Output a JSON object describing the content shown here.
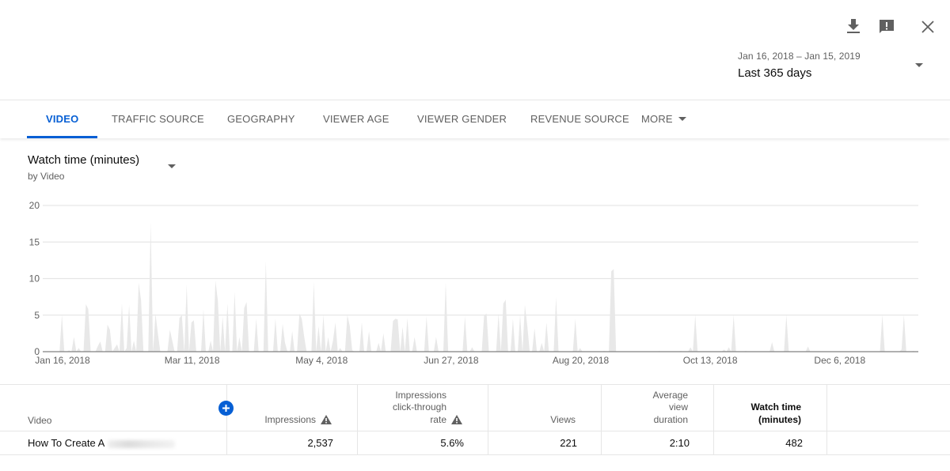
{
  "header": {
    "icons": [
      "download-icon",
      "feedback-icon",
      "close-icon"
    ],
    "date_range": "Jan 16, 2018 – Jan 15, 2019",
    "date_preset": "Last 365 days"
  },
  "tabs": [
    {
      "label": "VIDEO",
      "active": true
    },
    {
      "label": "TRAFFIC SOURCE",
      "active": false
    },
    {
      "label": "GEOGRAPHY",
      "active": false
    },
    {
      "label": "VIEWER AGE",
      "active": false
    },
    {
      "label": "VIEWER GENDER",
      "active": false
    },
    {
      "label": "REVENUE SOURCE",
      "active": false
    },
    {
      "label": "MORE",
      "active": false
    }
  ],
  "metric": {
    "title": "Watch time (minutes)",
    "subtitle": "by Video"
  },
  "accent_color": "#065fd4",
  "chart_data": {
    "type": "area",
    "title": "Watch time (minutes)",
    "xlabel": "",
    "ylabel": "",
    "ylim": [
      0,
      20
    ],
    "yticks": [
      "0",
      "5",
      "10",
      "15",
      "20"
    ],
    "xticks": [
      "Jan 16, 2018",
      "Mar 11, 2018",
      "May 4, 2018",
      "Jun 27, 2018",
      "Aug 20, 2018",
      "Oct 13, 2018",
      "Dec 6, 2018"
    ],
    "x_start": "Jan 16, 2018",
    "x_end": "Jan 15, 2019",
    "days": 365,
    "grid": true,
    "fill_color": "#e8e8e8",
    "series": [
      {
        "name": "Watch time (minutes)",
        "spikes": [
          [
            7,
            5
          ],
          [
            10,
            0.2
          ],
          [
            12,
            2
          ],
          [
            14,
            0.5
          ],
          [
            17,
            6.5
          ],
          [
            18,
            5.8
          ],
          [
            22,
            0.8
          ],
          [
            23,
            1.4
          ],
          [
            26,
            3.7
          ],
          [
            27,
            3
          ],
          [
            29,
            0.5
          ],
          [
            30,
            1
          ],
          [
            32,
            6.6
          ],
          [
            34,
            0.5
          ],
          [
            35,
            6.4
          ],
          [
            37,
            1.5
          ],
          [
            39,
            9.4
          ],
          [
            40,
            7
          ],
          [
            44,
            17.7
          ],
          [
            46,
            5.2
          ],
          [
            47,
            2.5
          ],
          [
            52,
            3
          ],
          [
            53,
            1.5
          ],
          [
            56,
            4.6
          ],
          [
            57,
            5
          ],
          [
            59,
            9.2
          ],
          [
            61,
            4
          ],
          [
            62,
            4.3
          ],
          [
            66,
            5.8
          ],
          [
            69,
            1.5
          ],
          [
            71,
            9.7
          ],
          [
            72,
            7
          ],
          [
            74,
            4.8
          ],
          [
            76,
            6.6
          ],
          [
            79,
            8.2
          ],
          [
            81,
            2
          ],
          [
            83,
            6
          ],
          [
            84,
            6.8
          ],
          [
            88,
            4.5
          ],
          [
            92,
            12.4
          ],
          [
            96,
            4.5
          ],
          [
            99,
            3.8
          ],
          [
            100,
            1.2
          ],
          [
            103,
            2.8
          ],
          [
            106,
            5.2
          ],
          [
            107,
            4.5
          ],
          [
            108,
            2
          ],
          [
            112,
            9.5
          ],
          [
            114,
            3.5
          ],
          [
            116,
            5
          ],
          [
            118,
            2
          ],
          [
            120,
            1.5
          ],
          [
            121,
            4
          ],
          [
            123,
            0.5
          ],
          [
            126,
            5
          ],
          [
            127,
            3.5
          ],
          [
            128,
            0.2
          ],
          [
            132,
            4
          ],
          [
            135,
            2.8
          ],
          [
            139,
            1.2
          ],
          [
            141,
            2.5
          ],
          [
            145,
            4.2
          ],
          [
            146,
            4.5
          ],
          [
            147,
            4.4
          ],
          [
            149,
            3.4
          ],
          [
            151,
            4.6
          ],
          [
            154,
            2
          ],
          [
            159,
            4.8
          ],
          [
            163,
            2
          ],
          [
            167,
            9.5
          ],
          [
            175,
            4.8
          ],
          [
            178,
            0.6
          ],
          [
            183,
            5
          ],
          [
            184,
            5.2
          ],
          [
            189,
            5.2
          ],
          [
            191,
            6.6
          ],
          [
            192,
            7.1
          ],
          [
            195,
            4.5
          ],
          [
            198,
            5
          ],
          [
            200,
            6.4
          ],
          [
            201,
            3.5
          ],
          [
            204,
            3.2
          ],
          [
            207,
            1.2
          ],
          [
            209,
            4
          ],
          [
            213,
            7.5
          ],
          [
            221,
            4.5
          ],
          [
            223,
            0.5
          ],
          [
            233,
            0.1
          ],
          [
            236,
            11
          ],
          [
            237,
            11.3
          ],
          [
            256,
            0.1
          ],
          [
            265,
            0.1
          ],
          [
            269,
            0.6
          ],
          [
            271,
            5
          ],
          [
            283,
            0.3
          ],
          [
            285,
            0.6
          ],
          [
            287,
            5
          ],
          [
            292,
            0.1
          ],
          [
            303,
            1.3
          ],
          [
            309,
            5
          ],
          [
            318,
            0.7
          ],
          [
            349,
            5
          ],
          [
            357,
            0.3
          ],
          [
            358,
            5
          ],
          [
            362,
            0.1
          ],
          [
            365,
            0.8
          ]
        ]
      }
    ]
  },
  "table": {
    "add_icon": "add-circle-icon",
    "columns": [
      {
        "label": "Video",
        "warning": false,
        "bold": false
      },
      {
        "label": "Impressions",
        "warning": true,
        "bold": false
      },
      {
        "label_lines": [
          "Impressions",
          "click-through",
          "rate"
        ],
        "warning": true,
        "bold": false
      },
      {
        "label": "Views",
        "warning": false,
        "bold": false
      },
      {
        "label_lines": [
          "Average",
          "view",
          "duration"
        ],
        "warning": false,
        "bold": false
      },
      {
        "label_lines": [
          "Watch time",
          "(minutes)"
        ],
        "warning": false,
        "bold": true
      }
    ],
    "rows": [
      {
        "video": "How To Create A",
        "impressions": "2,537",
        "ctr": "5.6%",
        "views": "221",
        "avg_view_duration": "2:10",
        "watch_time": "482"
      }
    ]
  }
}
